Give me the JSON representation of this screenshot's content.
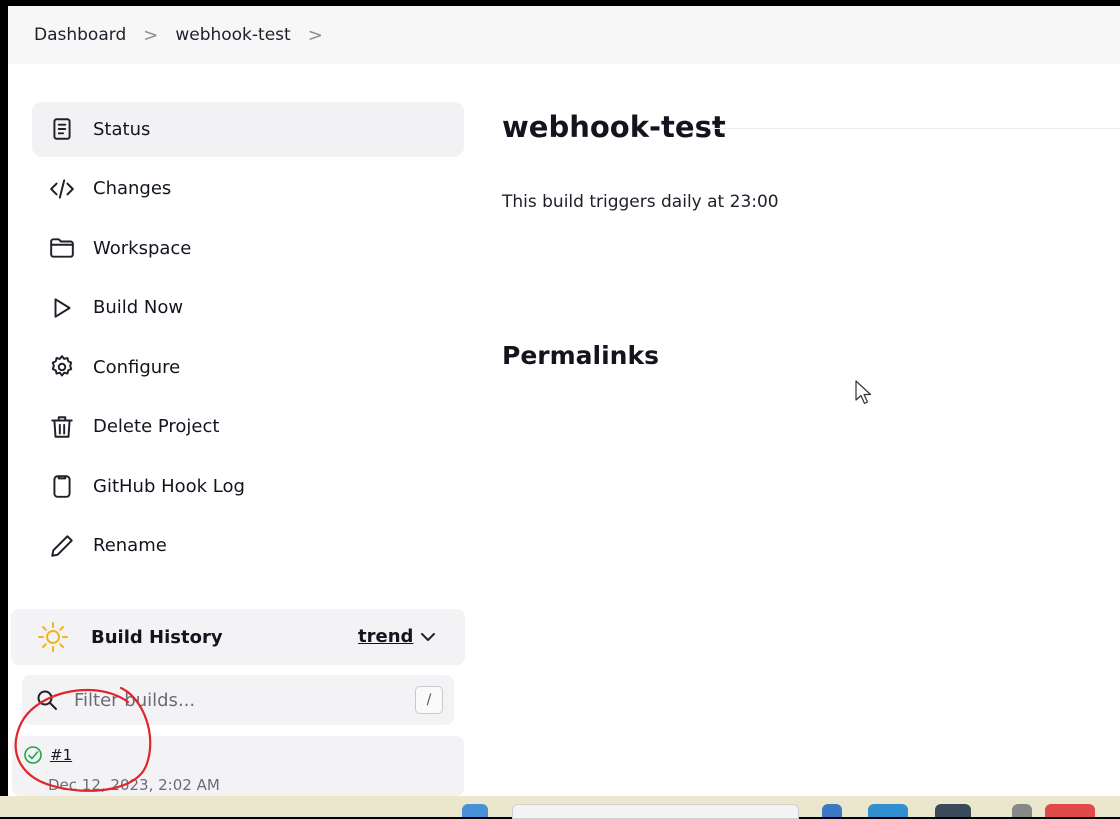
{
  "breadcrumb": {
    "items": [
      "Dashboard",
      "webhook-test"
    ],
    "separator": ">"
  },
  "sidebar": {
    "items": [
      {
        "label": "Status",
        "icon": "document-icon",
        "active": true
      },
      {
        "label": "Changes",
        "icon": "code-icon"
      },
      {
        "label": "Workspace",
        "icon": "folder-icon"
      },
      {
        "label": "Build Now",
        "icon": "play-icon"
      },
      {
        "label": "Configure",
        "icon": "gear-icon"
      },
      {
        "label": "Delete Project",
        "icon": "trash-icon"
      },
      {
        "label": "GitHub Hook Log",
        "icon": "clipboard-icon"
      },
      {
        "label": "Rename",
        "icon": "pencil-icon"
      }
    ]
  },
  "build_history": {
    "title": "Build History",
    "trend_label": "trend",
    "filter_placeholder": "Filter builds...",
    "shortcut_key": "/",
    "builds": [
      {
        "number": "#1",
        "date": "Dec 12, 2023, 2:02 AM",
        "status": "success"
      }
    ]
  },
  "main": {
    "title": "webhook-test",
    "trigger_text": "This build triggers daily at 23:00",
    "permalinks_heading": "Permalinks"
  },
  "colors": {
    "success": "#1ea64b",
    "annotation": "#e0252b",
    "sun": "#f5b31b"
  }
}
